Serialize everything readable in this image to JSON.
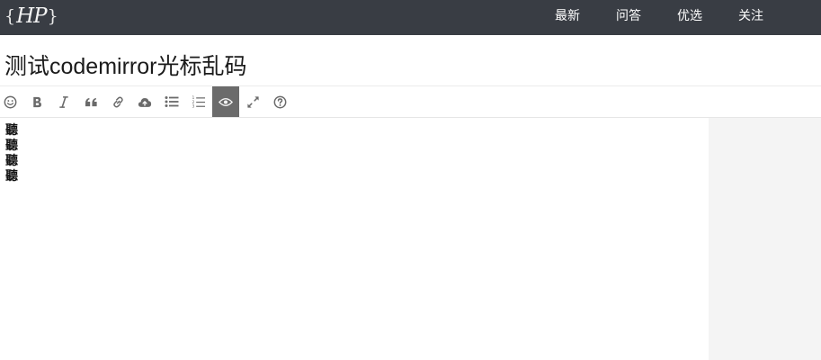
{
  "navbar": {
    "logo": {
      "left_brace": "{",
      "mark": "HP",
      "right_brace": "}"
    },
    "items": [
      {
        "label": "最新"
      },
      {
        "label": "问答"
      },
      {
        "label": "优选"
      },
      {
        "label": "关注"
      }
    ]
  },
  "title": "测试codemirror光标乱码",
  "toolbar": {
    "buttons": [
      {
        "icon": "smiley-icon"
      },
      {
        "icon": "bold-icon"
      },
      {
        "icon": "italic-icon"
      },
      {
        "icon": "quote-icon"
      },
      {
        "icon": "link-icon"
      },
      {
        "icon": "cloud-upload-icon"
      },
      {
        "icon": "bulleted-list-icon"
      },
      {
        "icon": "numbered-list-icon"
      },
      {
        "icon": "eye-icon",
        "active": true
      },
      {
        "icon": "fullscreen-icon"
      },
      {
        "icon": "help-icon"
      }
    ],
    "active_color": "#6b6b6b"
  },
  "editor": {
    "lines": [
      "聽",
      "聽",
      "聽",
      "聽"
    ]
  },
  "colors": {
    "navbar_bg": "#393d44",
    "preview_bg": "#f4f4f4"
  }
}
